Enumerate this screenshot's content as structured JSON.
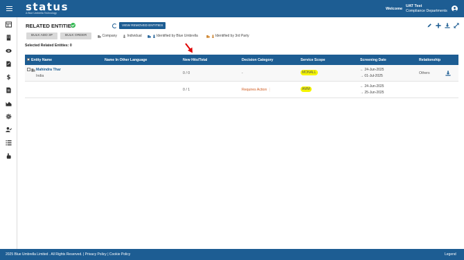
{
  "header": {
    "logo": "status",
    "logo_tagline": "A Blue Umbrella Technology",
    "welcome": "Welcome",
    "user_name": "UAT Test",
    "user_dept": "Compliance Departments"
  },
  "page": {
    "title": "RELATED ENTITIES",
    "view_removed": "VIEW REMOVED ENTITIES",
    "bulk_add": "BULK ADD 3P",
    "bulk_order": "BULK ORDER",
    "legend": {
      "company": "Company",
      "individual": "Individual",
      "identified_blue": "Identified by Blue Umbrella",
      "identified_3rd": "Identified by 3rd Party"
    },
    "selected_label": "Selected Related Entities: 0"
  },
  "table": {
    "headers": {
      "entity_name": "Entity Name",
      "other_language": "Name In Other Language",
      "new_hits": "New Hits/Total",
      "decision": "Decision Category",
      "scope": "Service Scope",
      "screening": "Screening Date",
      "relationship": "Relationship"
    },
    "rows": [
      {
        "name": "Mahindra Thar",
        "country": "India",
        "hits": "0 / 0",
        "decision": "-",
        "scope": "MONALL",
        "date_from": "24-Jun-2025",
        "date_to": "01-Jul-2025",
        "relationship": "Others"
      },
      {
        "name": "",
        "country": "",
        "hits": "0 / 1",
        "decision": "Requires Action",
        "scope": "AMM",
        "date_from": "24-Jun-2025",
        "date_to": "25-Jun-2025",
        "relationship": ""
      }
    ]
  },
  "footer": {
    "copyright": "2025 Blue Umbrella Limited . All Rights Reserved. |",
    "privacy": "Privacy Policy",
    "sep": "|",
    "cookie": "Cookie Policy",
    "legend": "Legend"
  },
  "colors": {
    "brand": "#1d5d93",
    "scope_badge": "#f5f500",
    "requires_action": "#d05a1e",
    "verified": "#2fb84f",
    "arrow": "#e00000"
  }
}
